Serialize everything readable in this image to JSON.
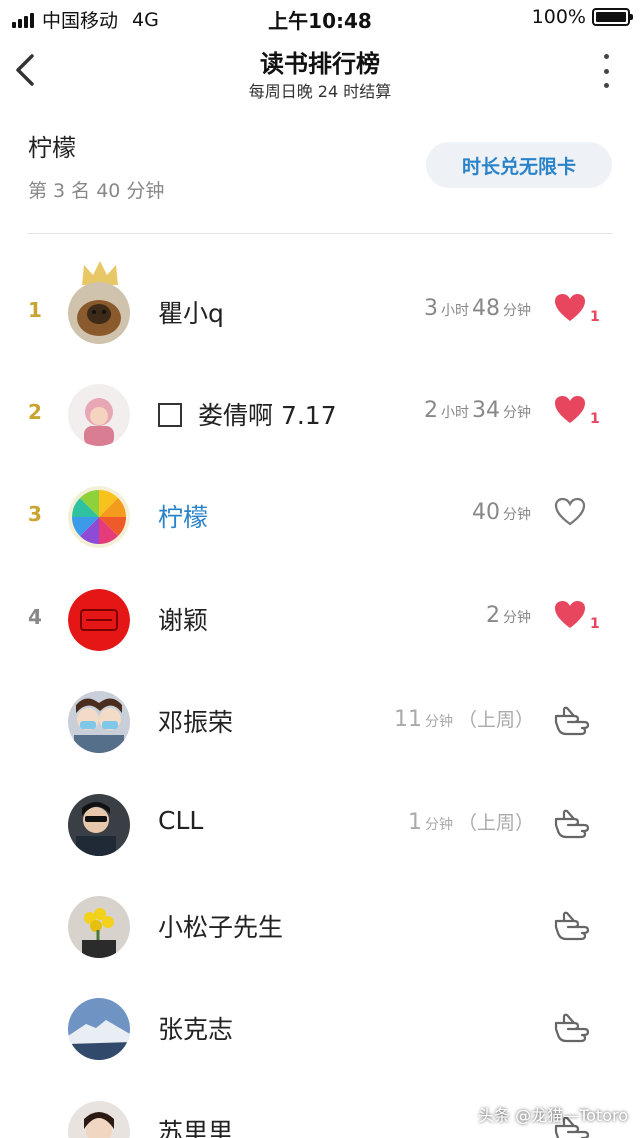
{
  "status_bar": {
    "carrier": "中国移动",
    "network": "4G",
    "time": "上午10:48",
    "battery": "100%"
  },
  "nav": {
    "title": "读书排行榜",
    "subtitle": "每周日晚 24 时结算"
  },
  "me": {
    "name": "柠檬",
    "rank_text": "第 3 名  40 分钟",
    "exchange_button": "时长兑无限卡"
  },
  "rows": [
    {
      "rank": "1",
      "name": "瞿小q",
      "h": "3",
      "h_unit": "小时",
      "m": "48",
      "m_unit": "分钟",
      "likes": "1"
    },
    {
      "rank": "2",
      "name": "娄倩啊 7.17",
      "h": "2",
      "h_unit": "小时",
      "m": "34",
      "m_unit": "分钟",
      "likes": "1"
    },
    {
      "rank": "3",
      "name": "柠檬",
      "m": "40",
      "m_unit": "分钟"
    },
    {
      "rank": "4",
      "name": "谢颖",
      "m": "2",
      "m_unit": "分钟",
      "likes": "1"
    },
    {
      "name": "邓振荣",
      "m": "11",
      "m_unit": "分钟",
      "period": "（上周）"
    },
    {
      "name": "CLL",
      "m": "1",
      "m_unit": "分钟",
      "period": "（上周）"
    },
    {
      "name": "小松子先生"
    },
    {
      "name": "张克志"
    },
    {
      "name": "苏里里"
    }
  ],
  "colors": {
    "accent": "#2a83c9",
    "gold_rank": "#c9a431",
    "gray_rank": "#888888",
    "heart": "#e8465f"
  },
  "icons": [
    "back-icon",
    "more-icon",
    "crown-icon",
    "heart-icon",
    "heart-outline-icon",
    "poke-hand-icon",
    "checkbox-icon"
  ],
  "watermark": "头条 @龙猫—Totoro"
}
